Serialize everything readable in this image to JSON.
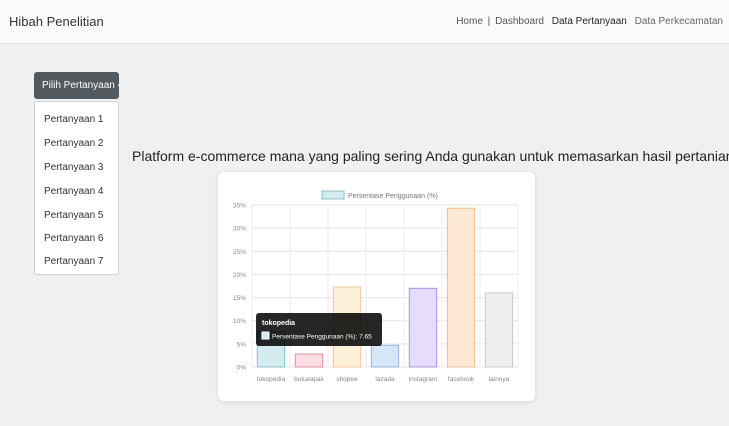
{
  "navbar": {
    "brand": "Hibah Penelitian",
    "links": {
      "home": "Home",
      "separator": "|",
      "dashboard": "Dashboard",
      "data_pertanyaan": "Data Pertanyaan",
      "data_perkecamatan": "Data Perkecamatan"
    }
  },
  "dropdown": {
    "button_label": "Pilih Pertanyaan",
    "caret": "▾",
    "items": [
      "Pertanyaan 1",
      "Pertanyaan 2",
      "Pertanyaan 3",
      "Pertanyaan 4",
      "Pertanyaan 5",
      "Pertanyaan 6",
      "Pertanyaan 7"
    ]
  },
  "question": "Platform e-commerce mana yang paling sering Anda gunakan untuk memasarkan hasil pertanian?",
  "chart_data": {
    "type": "bar",
    "categories": [
      "tokopedia",
      "bukalapak",
      "shopee",
      "lazada",
      "instagram",
      "facebook",
      "lainnya"
    ],
    "series": [
      {
        "name": "Persentase Penggunaan (%)",
        "values": [
          7.65,
          2.8,
          17.3,
          4.7,
          17.0,
          34.3,
          16.0
        ]
      }
    ],
    "ylim": [
      0,
      35
    ],
    "yticks": [
      "0%",
      "5%",
      "10%",
      "15%",
      "20%",
      "25%",
      "30%",
      "35%"
    ],
    "legend": "top",
    "grid": true,
    "bar_fills": [
      "#d4ecf0",
      "#fbdde3",
      "#fdf0d8",
      "#d7e6f7",
      "#e6dcfb",
      "#fde8d4",
      "#efefef"
    ],
    "bar_strokes": [
      "#7cc4cf",
      "#f08aa0",
      "#f5c98a",
      "#8ab8e8",
      "#ab93ef",
      "#f5bd87",
      "#c8c8c8"
    ],
    "tooltip": {
      "title": "tokopedia",
      "label": "Persentase Penggunaan (%): 7.65"
    }
  }
}
